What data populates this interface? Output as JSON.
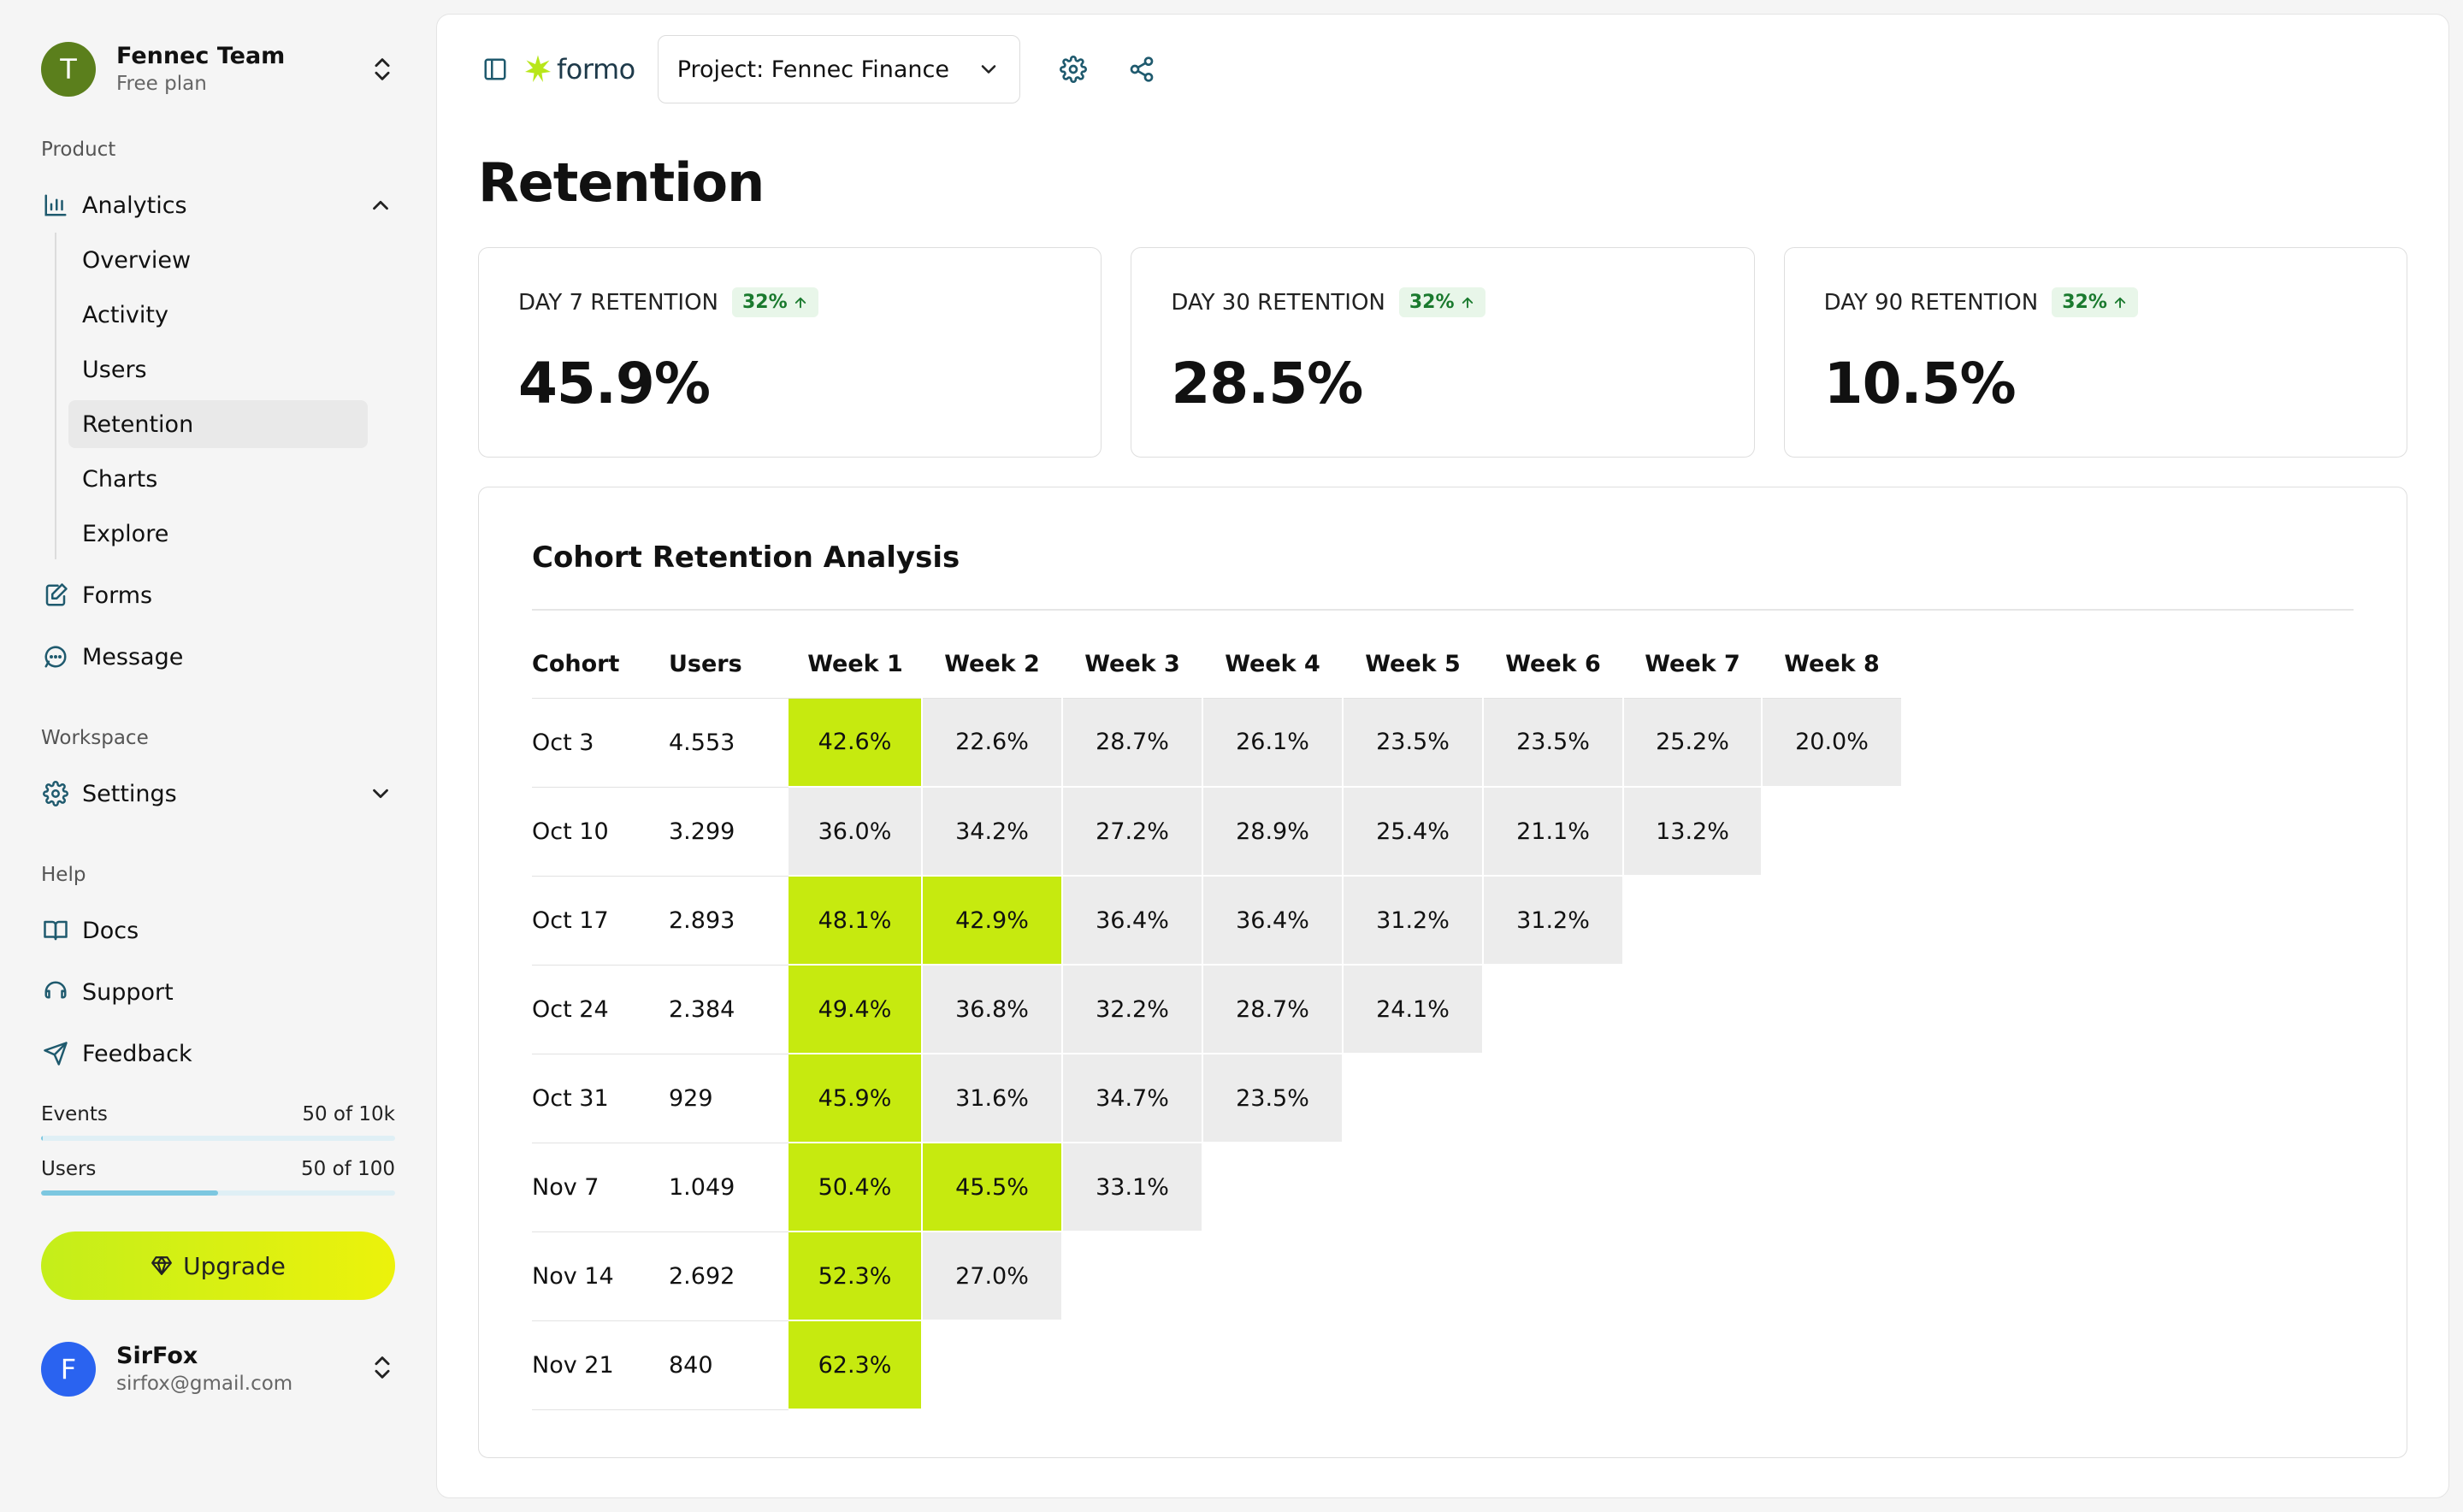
{
  "team": {
    "initial": "T",
    "name": "Fennec Team",
    "plan": "Free plan"
  },
  "sections": {
    "product": "Product",
    "workspace": "Workspace",
    "help": "Help"
  },
  "nav": {
    "analytics": "Analytics",
    "sub": [
      "Overview",
      "Activity",
      "Users",
      "Retention",
      "Charts",
      "Explore"
    ],
    "forms": "Forms",
    "message": "Message",
    "settings": "Settings",
    "docs": "Docs",
    "support": "Support",
    "feedback": "Feedback"
  },
  "usage": {
    "events": {
      "label": "Events",
      "value": "50 of 10k",
      "fraction": 0.005
    },
    "users": {
      "label": "Users",
      "value": "50 of 100",
      "fraction": 0.5
    }
  },
  "upgrade_label": "Upgrade",
  "user": {
    "initial": "F",
    "name": "SirFox",
    "email": "sirfox@gmail.com"
  },
  "topbar": {
    "logo_text": "formo",
    "project": "Project: Fennec Finance"
  },
  "page_title": "Retention",
  "cards": [
    {
      "label": "DAY 7 RETENTION",
      "badge": "32%",
      "value": "45.9%"
    },
    {
      "label": "DAY 30 RETENTION",
      "badge": "32%",
      "value": "28.5%"
    },
    {
      "label": "DAY 90 RETENTION",
      "badge": "32%",
      "value": "10.5%"
    }
  ],
  "cohort": {
    "title": "Cohort Retention Analysis",
    "headers": [
      "Cohort",
      "Users",
      "Week 1",
      "Week 2",
      "Week 3",
      "Week 4",
      "Week 5",
      "Week 6",
      "Week 7",
      "Week 8"
    ],
    "rows": [
      {
        "cohort": "Oct 3",
        "users": "4.553",
        "weeks": [
          "42.6%",
          "22.6%",
          "28.7%",
          "26.1%",
          "23.5%",
          "23.5%",
          "25.2%",
          "20.0%"
        ],
        "highlight": [
          0
        ]
      },
      {
        "cohort": "Oct 10",
        "users": "3.299",
        "weeks": [
          "36.0%",
          "34.2%",
          "27.2%",
          "28.9%",
          "25.4%",
          "21.1%",
          "13.2%"
        ],
        "highlight": []
      },
      {
        "cohort": "Oct 17",
        "users": "2.893",
        "weeks": [
          "48.1%",
          "42.9%",
          "36.4%",
          "36.4%",
          "31.2%",
          "31.2%"
        ],
        "highlight": [
          0,
          1
        ]
      },
      {
        "cohort": "Oct 24",
        "users": "2.384",
        "weeks": [
          "49.4%",
          "36.8%",
          "32.2%",
          "28.7%",
          "24.1%"
        ],
        "highlight": [
          0
        ]
      },
      {
        "cohort": "Oct 31",
        "users": "929",
        "weeks": [
          "45.9%",
          "31.6%",
          "34.7%",
          "23.5%"
        ],
        "highlight": [
          0
        ]
      },
      {
        "cohort": "Nov 7",
        "users": "1.049",
        "weeks": [
          "50.4%",
          "45.5%",
          "33.1%"
        ],
        "highlight": [
          0,
          1
        ]
      },
      {
        "cohort": "Nov 14",
        "users": "2.692",
        "weeks": [
          "52.3%",
          "27.0%"
        ],
        "highlight": [
          0
        ]
      },
      {
        "cohort": "Nov 21",
        "users": "840",
        "weeks": [
          "62.3%"
        ],
        "highlight": [
          0
        ]
      }
    ]
  },
  "colors": {
    "highlight": "#c6ea0f",
    "cell": "#ececec",
    "badge_text": "#1a7a2e",
    "badge_bg": "#e8f6e9",
    "upgrade": "#d7ef14"
  }
}
